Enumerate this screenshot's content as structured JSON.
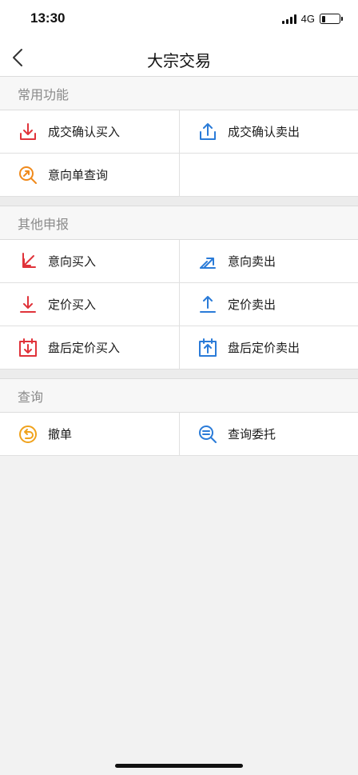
{
  "status_bar": {
    "time": "13:30",
    "network": "4G",
    "battery_level": 0.22
  },
  "nav": {
    "title": "大宗交易",
    "back_icon": "chevron-left-icon"
  },
  "sections": [
    {
      "title": "常用功能",
      "items": [
        {
          "label": "成交确认买入",
          "icon": "tray-download-icon",
          "color": "#e0333a"
        },
        {
          "label": "成交确认卖出",
          "icon": "tray-upload-icon",
          "color": "#2a7bd8"
        },
        {
          "label": "意向单查询",
          "icon": "search-arrow-icon",
          "color": "#f08a1c"
        }
      ]
    },
    {
      "title": "其他申报",
      "items": [
        {
          "label": "意向买入",
          "icon": "arrow-down-left-icon",
          "color": "#e0333a"
        },
        {
          "label": "意向卖出",
          "icon": "arrow-up-right-icon",
          "color": "#2a7bd8"
        },
        {
          "label": "定价买入",
          "icon": "arrow-down-bar-icon",
          "color": "#e0333a"
        },
        {
          "label": "定价卖出",
          "icon": "arrow-up-bar-icon",
          "color": "#2a7bd8"
        },
        {
          "label": "盘后定价买入",
          "icon": "calendar-down-icon",
          "color": "#e0333a"
        },
        {
          "label": "盘后定价卖出",
          "icon": "calendar-up-icon",
          "color": "#2a7bd8"
        }
      ]
    },
    {
      "title": "查询",
      "items": [
        {
          "label": "撤单",
          "icon": "undo-circle-icon",
          "color": "#f0a21c"
        },
        {
          "label": "查询委托",
          "icon": "search-lines-icon",
          "color": "#2a7bd8"
        }
      ]
    }
  ]
}
